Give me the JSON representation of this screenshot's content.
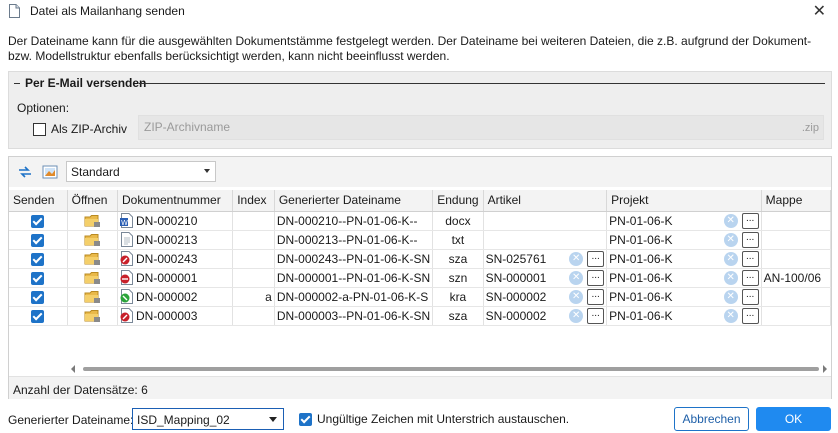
{
  "window": {
    "title": "Datei als Mailanhang senden",
    "close_glyph": "✕"
  },
  "description": "Der Dateiname kann für die ausgewählten Dokumentstämme festgelegt werden. Der Dateiname bei weiteren Dateien, die z.B. aufgrund der Dokument- bzw. Modellstruktur ebenfalls berücksichtigt werden, kann nicht beeinflusst werden.",
  "email_group": {
    "legend": "Per E-Mail versenden",
    "options_label": "Optionen:",
    "zip_checkbox_label": "Als ZIP-Archiv",
    "zip_checked": false,
    "zip_placeholder": "ZIP-Archivname",
    "zip_suffix": ".zip"
  },
  "toolbar": {
    "view_select": "Standard",
    "icons": [
      "refresh-arrows-icon",
      "image-preview-icon"
    ]
  },
  "grid": {
    "columns": [
      "Senden",
      "Öffnen",
      "Dokumentnummer",
      "Index",
      "Generierter Dateiname",
      "Endung",
      "Artikel",
      "Projekt",
      "Mappe"
    ],
    "rows": [
      {
        "send": true,
        "docnum": "DN-000210",
        "icon": "word-doc-icon",
        "index": "",
        "filename": "DN-000210--PN-01-06-K--",
        "ext": "docx",
        "artikel": "",
        "artikel_tools": false,
        "projekt": "PN-01-06-K",
        "mappe": "",
        "mappe_tools": false
      },
      {
        "send": true,
        "docnum": "DN-000213",
        "icon": "text-doc-icon",
        "index": "",
        "filename": "DN-000213--PN-01-06-K--",
        "ext": "txt",
        "artikel": "",
        "artikel_tools": false,
        "projekt": "PN-01-06-K",
        "mappe": "",
        "mappe_tools": false
      },
      {
        "send": true,
        "docnum": "DN-000243",
        "icon": "cad-assembly-icon",
        "index": "",
        "filename": "DN-000243--PN-01-06-K-SN",
        "ext": "sza",
        "artikel": "SN-025761",
        "artikel_tools": true,
        "projekt": "PN-01-06-K",
        "mappe": "",
        "mappe_tools": false
      },
      {
        "send": true,
        "docnum": "DN-000001",
        "icon": "cad-drawing-icon",
        "index": "",
        "filename": "DN-000001--PN-01-06-K-SN",
        "ext": "szn",
        "artikel": "SN-000001",
        "artikel_tools": true,
        "projekt": "PN-01-06-K",
        "mappe": "AN-100/06",
        "mappe_tools": false
      },
      {
        "send": true,
        "docnum": "DN-000002",
        "icon": "cad-part-icon",
        "index": "a",
        "filename": "DN-000002-a-PN-01-06-K-S",
        "ext": "kra",
        "artikel": "SN-000002",
        "artikel_tools": true,
        "projekt": "PN-01-06-K",
        "mappe": "",
        "mappe_tools": false
      },
      {
        "send": true,
        "docnum": "DN-000003",
        "icon": "cad-assembly-icon",
        "index": "",
        "filename": "DN-000003--PN-01-06-K-SN",
        "ext": "sza",
        "artikel": "SN-000002",
        "artikel_tools": true,
        "projekt": "PN-01-06-K",
        "mappe": "",
        "mappe_tools": false
      }
    ],
    "record_count": "Anzahl der Datensätze: 6"
  },
  "footer": {
    "filename_label": "Generierter Dateiname:",
    "filename_value": "ISD_Mapping_02",
    "replace_label": "Ungültige Zeichen mit Unterstrich austauschen.",
    "replace_checked": true,
    "cancel_label": "Abbrechen",
    "ok_label": "OK"
  },
  "colors": {
    "accent": "#1f8af0",
    "checkbox": "#1e73c8",
    "panel": "#eeeeee",
    "clear_button": "#b9d4ef"
  }
}
